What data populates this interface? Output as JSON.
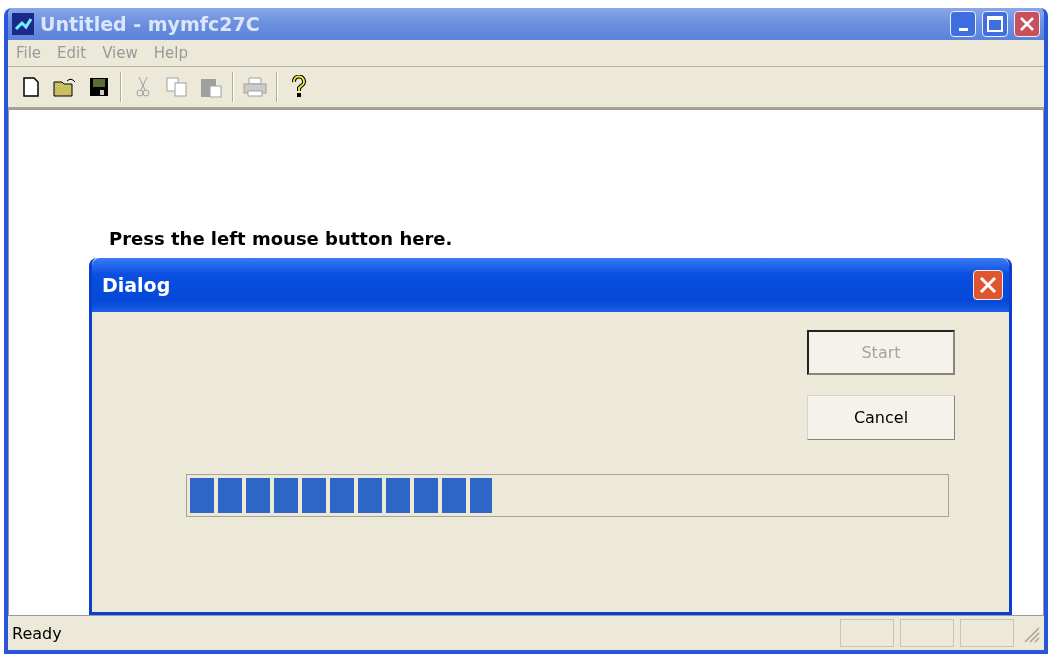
{
  "window": {
    "title": "Untitled - mymfc27C"
  },
  "menu": [
    {
      "label": "File"
    },
    {
      "label": "Edit"
    },
    {
      "label": "View"
    },
    {
      "label": "Help"
    }
  ],
  "toolbar": [
    {
      "kind": "new",
      "disabled": false
    },
    {
      "kind": "open",
      "disabled": false
    },
    {
      "kind": "save",
      "disabled": false
    },
    {
      "kind": "separator"
    },
    {
      "kind": "cut",
      "disabled": true
    },
    {
      "kind": "copy",
      "disabled": true
    },
    {
      "kind": "paste",
      "disabled": true
    },
    {
      "kind": "separator"
    },
    {
      "kind": "print",
      "disabled": true
    },
    {
      "kind": "separator"
    },
    {
      "kind": "help",
      "disabled": false
    }
  ],
  "client": {
    "text": "Press the left mouse button here."
  },
  "dialog": {
    "title": "Dialog",
    "buttons": [
      {
        "label": "Start",
        "disabled": true,
        "default": true
      },
      {
        "label": "Cancel",
        "disabled": false,
        "default": false
      }
    ],
    "progress": {
      "level": 0.4
    }
  },
  "status_bar": {
    "text": "Ready"
  }
}
